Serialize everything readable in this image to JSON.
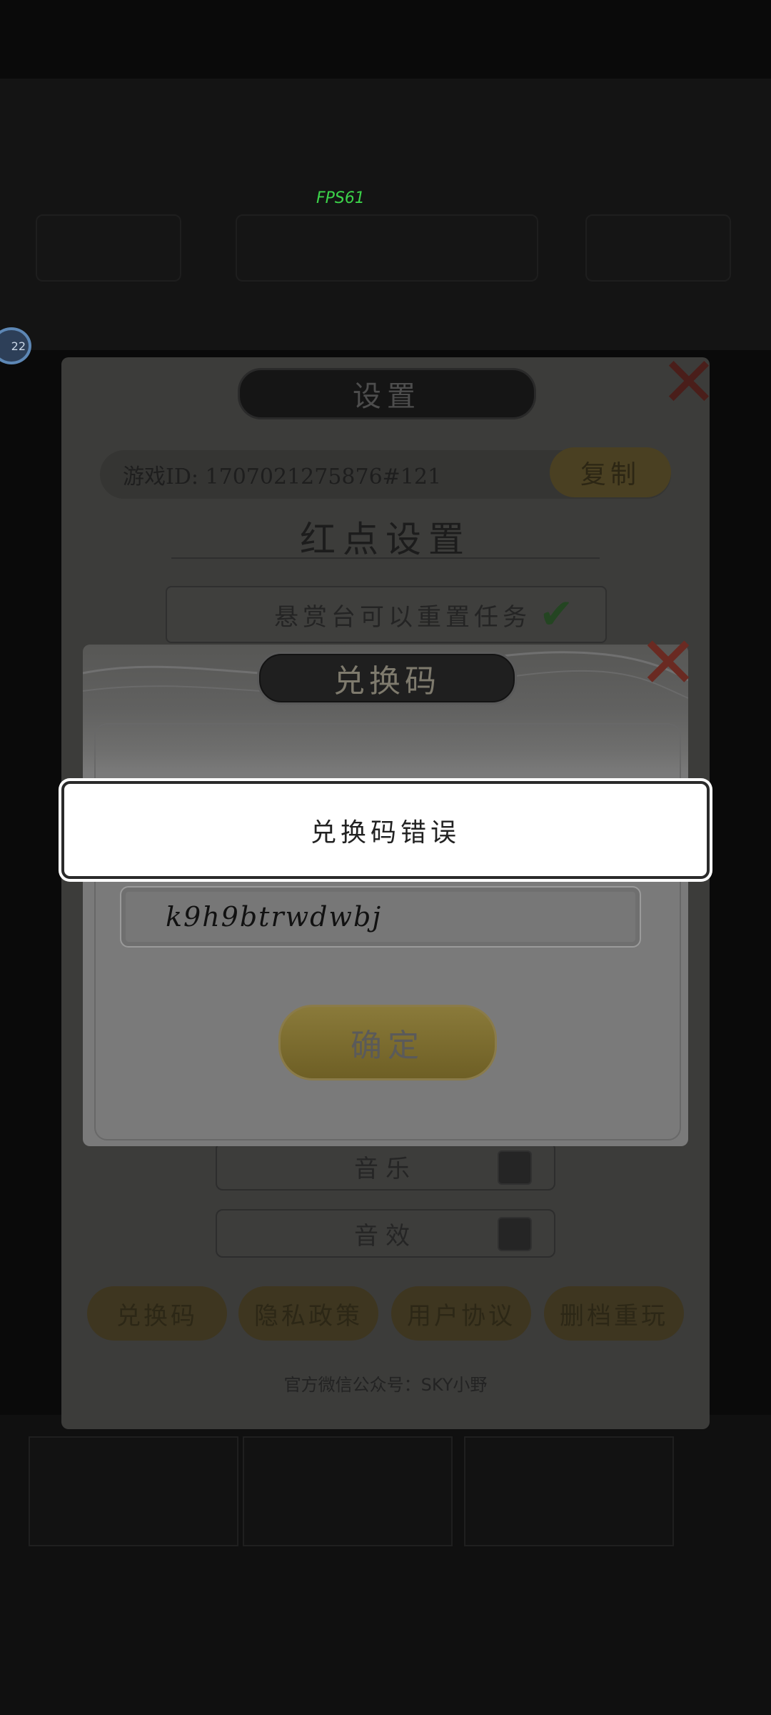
{
  "hud": {
    "fps": "FPS61",
    "badge": "22"
  },
  "settings": {
    "title": "设置",
    "game_id": "游戏ID: 1707021275876#121",
    "copy_label": "复制",
    "redpoint_title": "红点设置",
    "reset_task_label": "悬赏台可以重置任务",
    "music_label": "音乐",
    "sound_label": "音效",
    "buttons": [
      "兑换码",
      "隐私政策",
      "用户协议",
      "删档重玩"
    ],
    "wechat": "官方微信公众号：SKY小野"
  },
  "redeem": {
    "title": "兑换码",
    "code_value": "k9h9btrwdwbj",
    "confirm_label": "确定"
  },
  "toast": {
    "message": "兑换码错误"
  }
}
